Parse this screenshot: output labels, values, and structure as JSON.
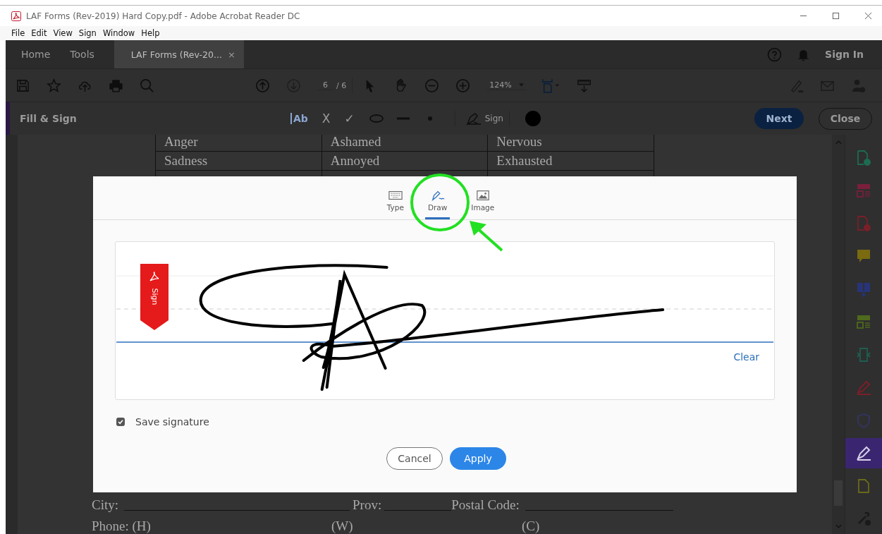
{
  "window": {
    "title": "LAF Forms (Rev-2019) Hard Copy.pdf - Adobe Acrobat Reader DC"
  },
  "menu": [
    "File",
    "Edit",
    "View",
    "Sign",
    "Window",
    "Help"
  ],
  "tabs": [
    {
      "label": "Home",
      "selected": false,
      "kind": "nav"
    },
    {
      "label": "Tools",
      "selected": false,
      "kind": "nav"
    },
    {
      "label": "LAF Forms (Rev-20...",
      "selected": true,
      "kind": "document",
      "close": "×"
    }
  ],
  "sign_in": "Sign In",
  "toolbar": {
    "page": "6",
    "page_total": "/ 6",
    "zoom": "124%"
  },
  "fill_sign": {
    "title": "Fill & Sign",
    "text_tool": "Ab",
    "cross": "X",
    "check": "✓",
    "sign": "Sign",
    "next": "Next",
    "close": "Close"
  },
  "document": {
    "rows": [
      [
        "Anger",
        "Ashamed",
        "Nervous"
      ],
      [
        "Sadness",
        "Annoyed",
        "Exhausted"
      ]
    ],
    "city": "City:",
    "prov": "Prov:",
    "postal": "Postal Code:",
    "phone_h": "Phone: (H)",
    "phone_w": "(W)",
    "phone_c": "(C)"
  },
  "dialog": {
    "tabs": [
      {
        "label": "Type",
        "kind": "keyboard",
        "selected": false
      },
      {
        "label": "Draw",
        "kind": "pen",
        "selected": true
      },
      {
        "label": "Image",
        "kind": "image",
        "selected": false
      }
    ],
    "flag": "Sign",
    "clear": "Clear",
    "save_signature": {
      "label": "Save signature",
      "checked": true
    },
    "cancel": "Cancel",
    "apply": "Apply"
  },
  "tools": [
    {
      "kind": "doc-plus",
      "color": "#1d6b50",
      "selected": false
    },
    {
      "kind": "layout",
      "color": "#7a1f3c",
      "selected": false
    },
    {
      "kind": "doc-plus",
      "color": "#7a1f28",
      "selected": false
    },
    {
      "kind": "comment",
      "color": "#7a6a10",
      "selected": false
    },
    {
      "kind": "combine",
      "color": "#27347a",
      "selected": false
    },
    {
      "kind": "layout",
      "color": "#4f6a1c",
      "selected": false
    },
    {
      "kind": "compress",
      "color": "#1d5e50",
      "selected": false
    },
    {
      "kind": "pen",
      "color": "#7a1f28",
      "selected": false
    },
    {
      "kind": "shield",
      "color": "#33335e",
      "selected": false
    },
    {
      "kind": "pen",
      "color": "#d8d0ea",
      "selected": true
    },
    {
      "kind": "doc",
      "color": "#6a6a1a",
      "selected": false
    },
    {
      "kind": "wrench",
      "color": "#1a1a1a",
      "selected": false
    }
  ]
}
